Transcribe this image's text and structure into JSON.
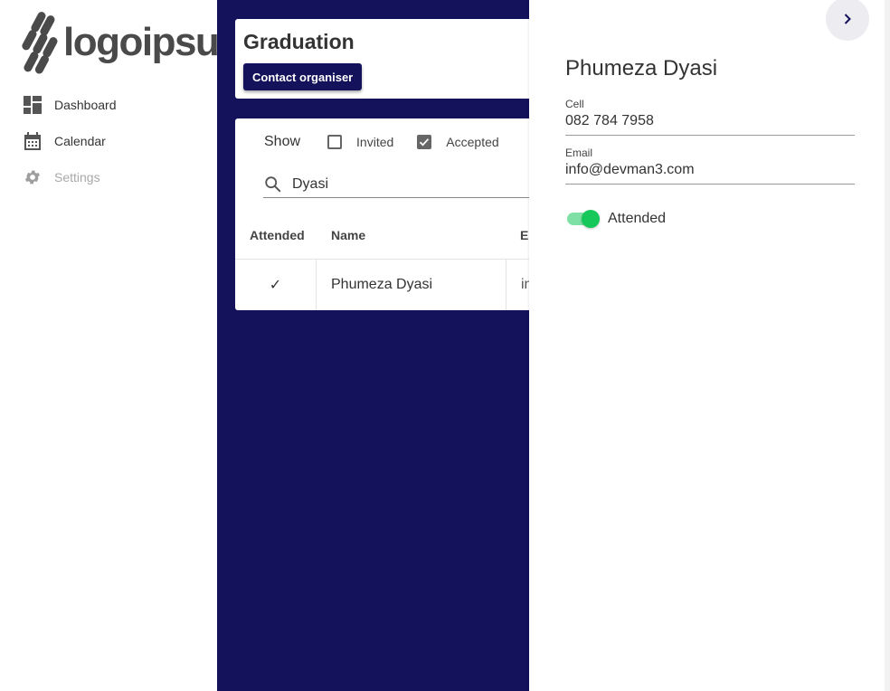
{
  "app": {
    "logo_text": "logoipsum"
  },
  "sidebar": {
    "items": [
      {
        "label": "Dashboard",
        "icon": "dashboard-icon",
        "enabled": true
      },
      {
        "label": "Calendar",
        "icon": "calendar-icon",
        "enabled": true
      },
      {
        "label": "Settings",
        "icon": "gear-icon",
        "enabled": false
      }
    ]
  },
  "event": {
    "title": "Graduation",
    "contact_button_label": "Contact organiser"
  },
  "filters": {
    "show_label": "Show",
    "options": [
      {
        "label": "Invited",
        "checked": false
      },
      {
        "label": "Accepted",
        "checked": true
      }
    ]
  },
  "search": {
    "value": "Dyasi"
  },
  "table": {
    "columns": [
      "Attended",
      "Name",
      "Er"
    ],
    "rows": [
      {
        "attended": "✓",
        "name": "Phumeza Dyasi",
        "email": "in"
      }
    ]
  },
  "drawer": {
    "name": "Phumeza Dyasi",
    "cell_label": "Cell",
    "cell_value": "082 784 7958",
    "email_label": "Email",
    "email_value": "info@devman3.com",
    "attended_label": "Attended",
    "attended_on": true
  },
  "colors": {
    "navy": "#13125a",
    "toggle_green": "#16c85a"
  }
}
